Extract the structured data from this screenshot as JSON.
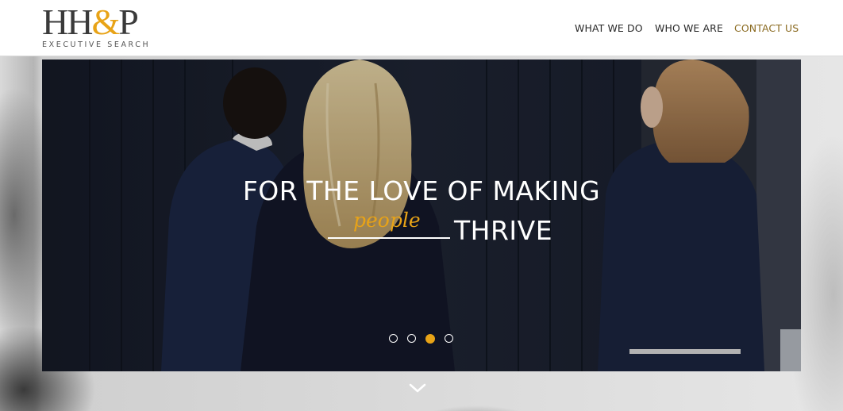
{
  "brand": {
    "logo_main": "HH",
    "logo_amp": "&",
    "logo_end": "P",
    "tagline": "EXECUTIVE SEARCH",
    "accent_color": "#e8a317"
  },
  "nav": {
    "items": [
      {
        "label": "WHAT WE DO",
        "active": false
      },
      {
        "label": "WHO WE ARE",
        "active": false
      },
      {
        "label": "CONTACT US",
        "active": true
      }
    ]
  },
  "hero": {
    "line1": "FOR THE LOVE OF MAKING",
    "handwritten": "people",
    "line2_end": "THRIVE",
    "slides_total": 4,
    "active_slide": 3
  },
  "icons": {
    "scroll": "chevron-down-icon",
    "slide_indicator": "dot-icon"
  }
}
